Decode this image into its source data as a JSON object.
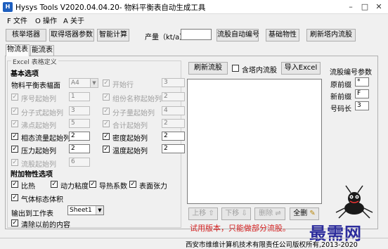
{
  "window": {
    "title": "Hysys Tools V2020.04.04.20- 物料平衡表自动生成工具",
    "minimize": "–",
    "maximize": "□",
    "close": "✕"
  },
  "menu": {
    "file": "F 文件",
    "ops": "O 操作",
    "about": "A 关于"
  },
  "toolbar": {
    "hysys_btn": "核举塔器",
    "params_btn": "取得塔器参数",
    "calc_btn": "智能计算",
    "output_label": "产量（kt/a）",
    "output_value": "",
    "auto_number_btn": "流股自动编号",
    "basic_props_btn": "基础物性",
    "refresh_in_tower_btn": "刷新塔内流股"
  },
  "tabs": [
    {
      "label": "物流表"
    },
    {
      "label": "能流表"
    }
  ],
  "excel_group": {
    "title": "Excel 表格定义",
    "basic_title": "基本选项",
    "sheet_format": {
      "label": "物料平衡表幅面",
      "value": "A4"
    },
    "start_row": {
      "label": "开始行",
      "value": "3",
      "checked": true
    },
    "serial_col": {
      "label": "序号起始列",
      "value": "1",
      "checked": true
    },
    "component_name_col": {
      "label": "组份名称起始列",
      "value": "2",
      "checked": true
    },
    "molecular_formula_col": {
      "label": "分子式起始列",
      "value": "3",
      "checked": true
    },
    "molecular_weight_col": {
      "label": "分子量起始列",
      "value": "4",
      "checked": true
    },
    "boiling_point_col": {
      "label": "沸点起始列",
      "value": "5",
      "checked": true
    },
    "total_col": {
      "label": "合计起始列",
      "value": "2",
      "checked": true
    },
    "phase_flow_col": {
      "label": "相态流量起始列",
      "value": "2",
      "checked": true
    },
    "density_col": {
      "label": "密度起始列",
      "value": "2",
      "checked": true
    },
    "pressure_col": {
      "label": "压力起始列",
      "value": "2",
      "checked": true
    },
    "temperature_col": {
      "label": "温度起始列",
      "value": "2",
      "checked": true
    },
    "stream_no_col": {
      "label": "流股起始列",
      "value": "6",
      "checked": true
    },
    "extra_title": "附加物性选项",
    "specific_heat": {
      "label": "比热",
      "checked": true
    },
    "viscosity": {
      "label": "动力粘度",
      "checked": true
    },
    "thermal_cond": {
      "label": "导热系数",
      "checked": true
    },
    "surface_tension": {
      "label": "表面张力",
      "checked": true
    },
    "gas_std_volume": {
      "label": "气体标态体积",
      "checked": true
    },
    "output_sheet": {
      "label": "输出到工作表",
      "value": "Sheet1"
    },
    "clear_previous": {
      "label": "清除以前的内容",
      "checked": true
    }
  },
  "streams": {
    "refresh_btn": "刷新流股",
    "include_in_tower": {
      "label": "含塔内流股",
      "checked": false
    },
    "import_excel_btn": "导入Excel",
    "up_btn": "上移",
    "down_btn": "下移",
    "delete_btn": "删除",
    "select_all_btn": "全删",
    "trial_notice": "试用版本，只能做部分流股。"
  },
  "stream_params": {
    "title": "流股编号参数",
    "orig_prefix": {
      "label": "原前缀",
      "value": "*"
    },
    "new_prefix": {
      "label": "新前缀",
      "value": "F"
    },
    "number_length": {
      "label": "号码长",
      "value": "3"
    }
  },
  "status": {
    "copyright": "西安市维维计算机技术有限责任公司版权所有,2013-2020"
  },
  "watermark": {
    "text": "最需网"
  },
  "colors": {
    "accent": "#1e5fbf",
    "notice": "#d21f1f",
    "watermark": "#2c2c9c"
  }
}
